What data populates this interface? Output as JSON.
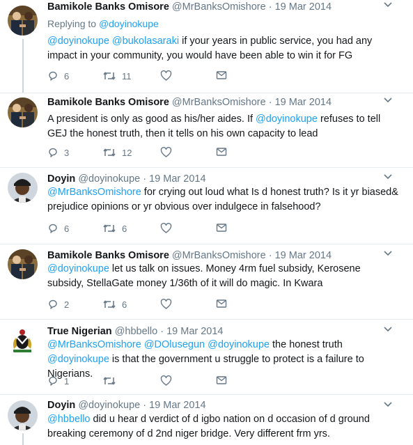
{
  "tweets": [
    {
      "avatar": "photo-handshake",
      "name": "Bamikole Banks Omisore",
      "handle": "@MrBanksOmishore",
      "date": "19 Mar 2014",
      "replying_to_prefix": "Replying to ",
      "replying_to": "@doyinokupe",
      "text": [
        {
          "t": "link",
          "v": "@doyinokupe"
        },
        {
          "t": "text",
          "v": " "
        },
        {
          "t": "link",
          "v": "@bukolasaraki"
        },
        {
          "t": "text",
          "v": " if your years in public service, you had any impact in your community, you would have been able to win it for FG"
        }
      ],
      "replies": "6",
      "retweets": "11",
      "likes": ""
    },
    {
      "avatar": "photo-handshake",
      "name": "Bamikole Banks Omisore",
      "handle": "@MrBanksOmishore",
      "date": "19 Mar 2014",
      "text": [
        {
          "t": "text",
          "v": "A president is only as good as his/her aides. If "
        },
        {
          "t": "link",
          "v": "@doyinokupe"
        },
        {
          "t": "text",
          "v": " refuses to tell GEJ the honest truth, then it tells on his own capacity to lead"
        }
      ],
      "replies": "3",
      "retweets": "12",
      "likes": ""
    },
    {
      "avatar": "photo-cap",
      "name": "Doyin",
      "handle": "@doyinokupe",
      "date": "19 Mar 2014",
      "text": [
        {
          "t": "link",
          "v": "@MrBanksOmishore"
        },
        {
          "t": "text",
          "v": " for crying out loud what Is d honest truth? Is it yr biased& prejudice opinions or yr obvious over indulgece in falsehood?"
        }
      ],
      "replies": "6",
      "retweets": "6",
      "likes": ""
    },
    {
      "avatar": "photo-handshake",
      "name": "Bamikole Banks Omisore",
      "handle": "@MrBanksOmishore",
      "date": "19 Mar 2014",
      "text": [
        {
          "t": "link",
          "v": "@doyinokupe"
        },
        {
          "t": "text",
          "v": " let us talk on issues. Money 4rm fuel subsidy, Kerosene subsidy, StellaGate money 1/36th of it will do magic. In Kwara"
        }
      ],
      "replies": "2",
      "retweets": "6",
      "likes": ""
    },
    {
      "avatar": "coat-of-arms",
      "name": "True Nigerian",
      "handle": "@hbbello",
      "date": "19 Mar 2014",
      "text": [
        {
          "t": "link",
          "v": "@MrBanksOmishore"
        },
        {
          "t": "text",
          "v": " "
        },
        {
          "t": "link",
          "v": "@DOlusegun"
        },
        {
          "t": "text",
          "v": " "
        },
        {
          "t": "link",
          "v": "@doyinokupe"
        },
        {
          "t": "text",
          "v": " the honest truth "
        },
        {
          "t": "link",
          "v": "@doyinokupe"
        },
        {
          "t": "text",
          "v": " is that the government u struggle to protect is a failure to Nigerians."
        }
      ],
      "replies": "1",
      "retweets": "",
      "likes": ""
    },
    {
      "avatar": "photo-cap",
      "name": "Doyin",
      "handle": "@doyinokupe",
      "date": "19 Mar 2014",
      "text": [
        {
          "t": "link",
          "v": "@hbbello"
        },
        {
          "t": "text",
          "v": " did u hear d verdict of d igbo nation on d occasion of d ground breaking ceremony of d 2nd niger bridge. Very different frm yrs."
        }
      ],
      "replies": "",
      "retweets": "",
      "likes": ""
    }
  ],
  "separator": " · ",
  "colors": {
    "link": "#1da1f2",
    "meta": "#657786",
    "line": "#ccd6dd"
  }
}
